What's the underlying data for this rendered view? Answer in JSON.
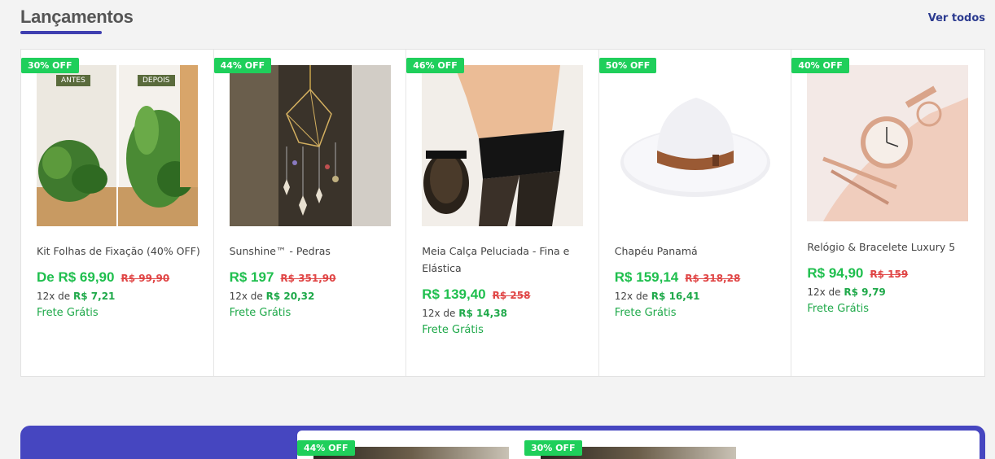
{
  "section": {
    "title": "Lançamentos",
    "see_all": "Ver todos"
  },
  "products": [
    {
      "badge": "30% OFF",
      "name": "Kit Folhas de Fixação (40% OFF)",
      "price": "De R$ 69,90",
      "old_price": "R$ 99,90",
      "installment_prefix": "12x de",
      "installment_value": "R$ 7,21",
      "shipping": "Frete Grátis",
      "tags": [
        "ANTES",
        "DEPOIS"
      ]
    },
    {
      "badge": "44% OFF",
      "name": "Sunshine™ - Pedras",
      "price": "R$ 197",
      "old_price": "R$ 351,90",
      "installment_prefix": "12x de",
      "installment_value": "R$ 20,32",
      "shipping": "Frete Grátis"
    },
    {
      "badge": "46% OFF",
      "name": "Meia Calça Peluciada - Fina e Elástica",
      "price": "R$ 139,40",
      "old_price": "R$ 258",
      "installment_prefix": "12x de",
      "installment_value": "R$ 14,38",
      "shipping": "Frete Grátis"
    },
    {
      "badge": "50% OFF",
      "name": "Chapéu Panamá",
      "price": "R$ 159,14",
      "old_price": "R$ 318,28",
      "installment_prefix": "12x de",
      "installment_value": "R$ 16,41",
      "shipping": "Frete Grátis"
    },
    {
      "badge": "40% OFF",
      "name": "Relógio & Bracelete Luxury 5",
      "price": "R$ 94,90",
      "old_price": "R$ 159",
      "installment_prefix": "12x de",
      "installment_value": "R$ 9,79",
      "shipping": "Frete Grátis"
    }
  ],
  "banner": {
    "badges": [
      "44% OFF",
      "30% OFF"
    ]
  },
  "colors": {
    "accent": "#3f3fb0",
    "price": "#1fbf4e",
    "badge": "#1fcf5b",
    "old_price": "#e04646",
    "banner": "#4646c0"
  }
}
